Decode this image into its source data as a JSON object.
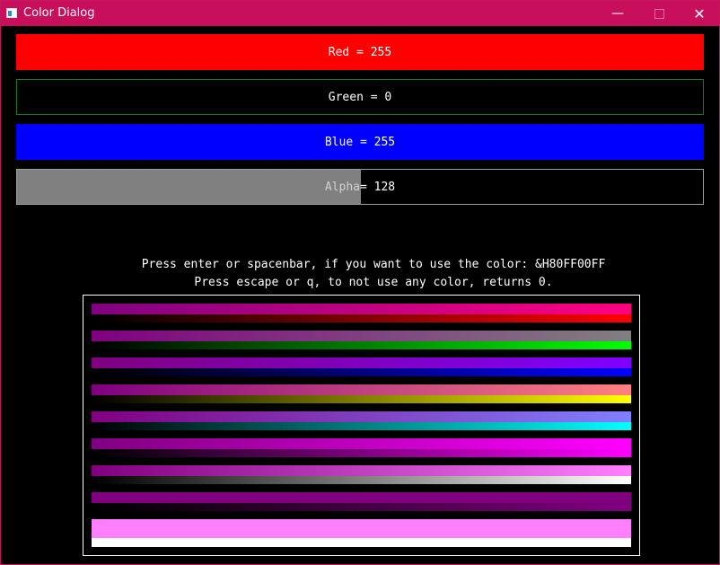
{
  "window": {
    "title": "Color Dialog",
    "controls": {
      "minimize": "—",
      "maximize": "",
      "close": "✕"
    },
    "accent_color": "#c70f5b"
  },
  "sliders": [
    {
      "name": "red",
      "label": "Red = 255",
      "value": 255,
      "color": "#ff0000"
    },
    {
      "name": "green",
      "label": "Green = 0",
      "value": 0,
      "color": "#00ff00"
    },
    {
      "name": "blue",
      "label": "Blue = 255",
      "value": 255,
      "color": "#0000ff"
    },
    {
      "name": "alpha",
      "label_prefix": "Alpha",
      "label_suffix": " = 128",
      "value": 128,
      "color": "#808080"
    }
  ],
  "instructions": {
    "line1": "Press enter or spacenbar, if you want to use the color: &H80FF00FF",
    "line2": "Press escape or q, to not use any color, returns 0."
  },
  "palette": {
    "base_color": "#800080",
    "rows": [
      {
        "name": "red",
        "end": "#ff0080",
        "underline": "#ff0000"
      },
      {
        "name": "gray",
        "end": "#808080",
        "underline": "#00ff00"
      },
      {
        "name": "violet",
        "end": "#8000ff",
        "underline": "#0000ff"
      },
      {
        "name": "salmon",
        "end": "#ff8080",
        "underline": "#ffff00"
      },
      {
        "name": "periwinkle",
        "end": "#8080ff",
        "underline": "#00ffff"
      },
      {
        "name": "magenta",
        "end": "#ff00ff",
        "underline": "#ff00ff"
      },
      {
        "name": "pink",
        "end": "#ff80ff",
        "underline": "#ffffff"
      },
      {
        "name": "plum",
        "end": "#800080",
        "underline": "#800080"
      },
      {
        "name": "light-pink",
        "end": "#ff80ff",
        "underline": "#ffffff"
      }
    ]
  }
}
